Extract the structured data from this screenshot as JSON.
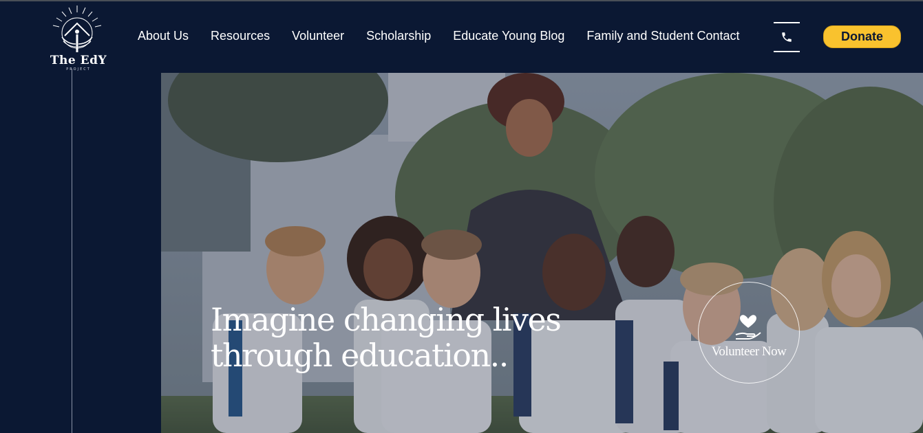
{
  "brand": {
    "wordmark": "The EdY",
    "subtitle": "PROJECT"
  },
  "nav": {
    "items": [
      {
        "label": "About Us"
      },
      {
        "label": "Resources"
      },
      {
        "label": "Volunteer"
      },
      {
        "label": "Scholarship"
      },
      {
        "label": "Educate Young Blog"
      },
      {
        "label": "Family and Student Contact"
      }
    ]
  },
  "header": {
    "phone_icon": "phone-icon",
    "donate_label": "Donate"
  },
  "hero": {
    "headline_line1": "Imagine changing lives",
    "headline_line2": "through education..",
    "volunteer_label": "Volunteer Now",
    "volunteer_icon": "heart-in-hand-icon"
  },
  "colors": {
    "background": "#0b1833",
    "accent": "#f9c22e",
    "text": "#ffffff"
  }
}
